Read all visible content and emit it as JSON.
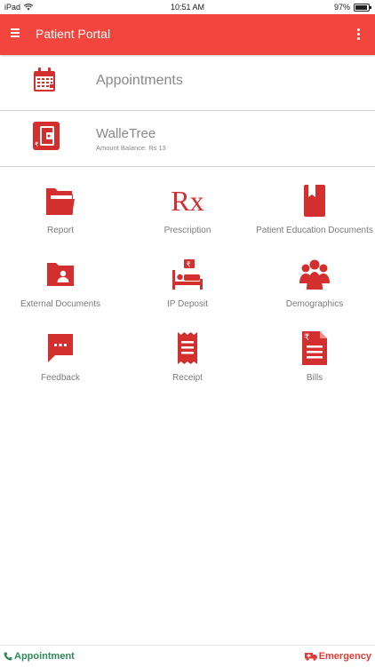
{
  "status_bar": {
    "device": "iPad",
    "time": "10:51 AM",
    "battery": "97%",
    "battery_level": 0.97
  },
  "app_bar": {
    "title": "Patient Portal",
    "menu_icon": "hamburger-menu-icon",
    "more_icon": "more-vertical-icon"
  },
  "appointments": {
    "label": "Appointments",
    "icon": "calendar-icon"
  },
  "wallet": {
    "label": "WalleTree",
    "balance": "Amount Balance: Rs 13",
    "icon": "wallet-icon"
  },
  "grid": {
    "items": [
      {
        "label": "Report",
        "icon": "folder-icon"
      },
      {
        "label": "Prescription",
        "icon": "rx-icon",
        "glyph": "Rx"
      },
      {
        "label": "Patient Education Documents",
        "icon": "book-icon"
      },
      {
        "label": "External Documents",
        "icon": "person-folder-icon"
      },
      {
        "label": "IP Deposit",
        "icon": "hospital-bed-icon"
      },
      {
        "label": "Demographics",
        "icon": "group-icon"
      },
      {
        "label": "Feedback",
        "icon": "chat-icon"
      },
      {
        "label": "Receipt",
        "icon": "receipt-icon"
      },
      {
        "label": "Bills",
        "icon": "rupee-document-icon"
      }
    ]
  },
  "bottom_bar": {
    "appointment": "Appointment",
    "emergency": "Emergency"
  },
  "colors": {
    "primary": "#f2453d",
    "icon_red": "#d32f2f",
    "appointment_green": "#2e8b57",
    "emergency_red": "#e03b35"
  }
}
